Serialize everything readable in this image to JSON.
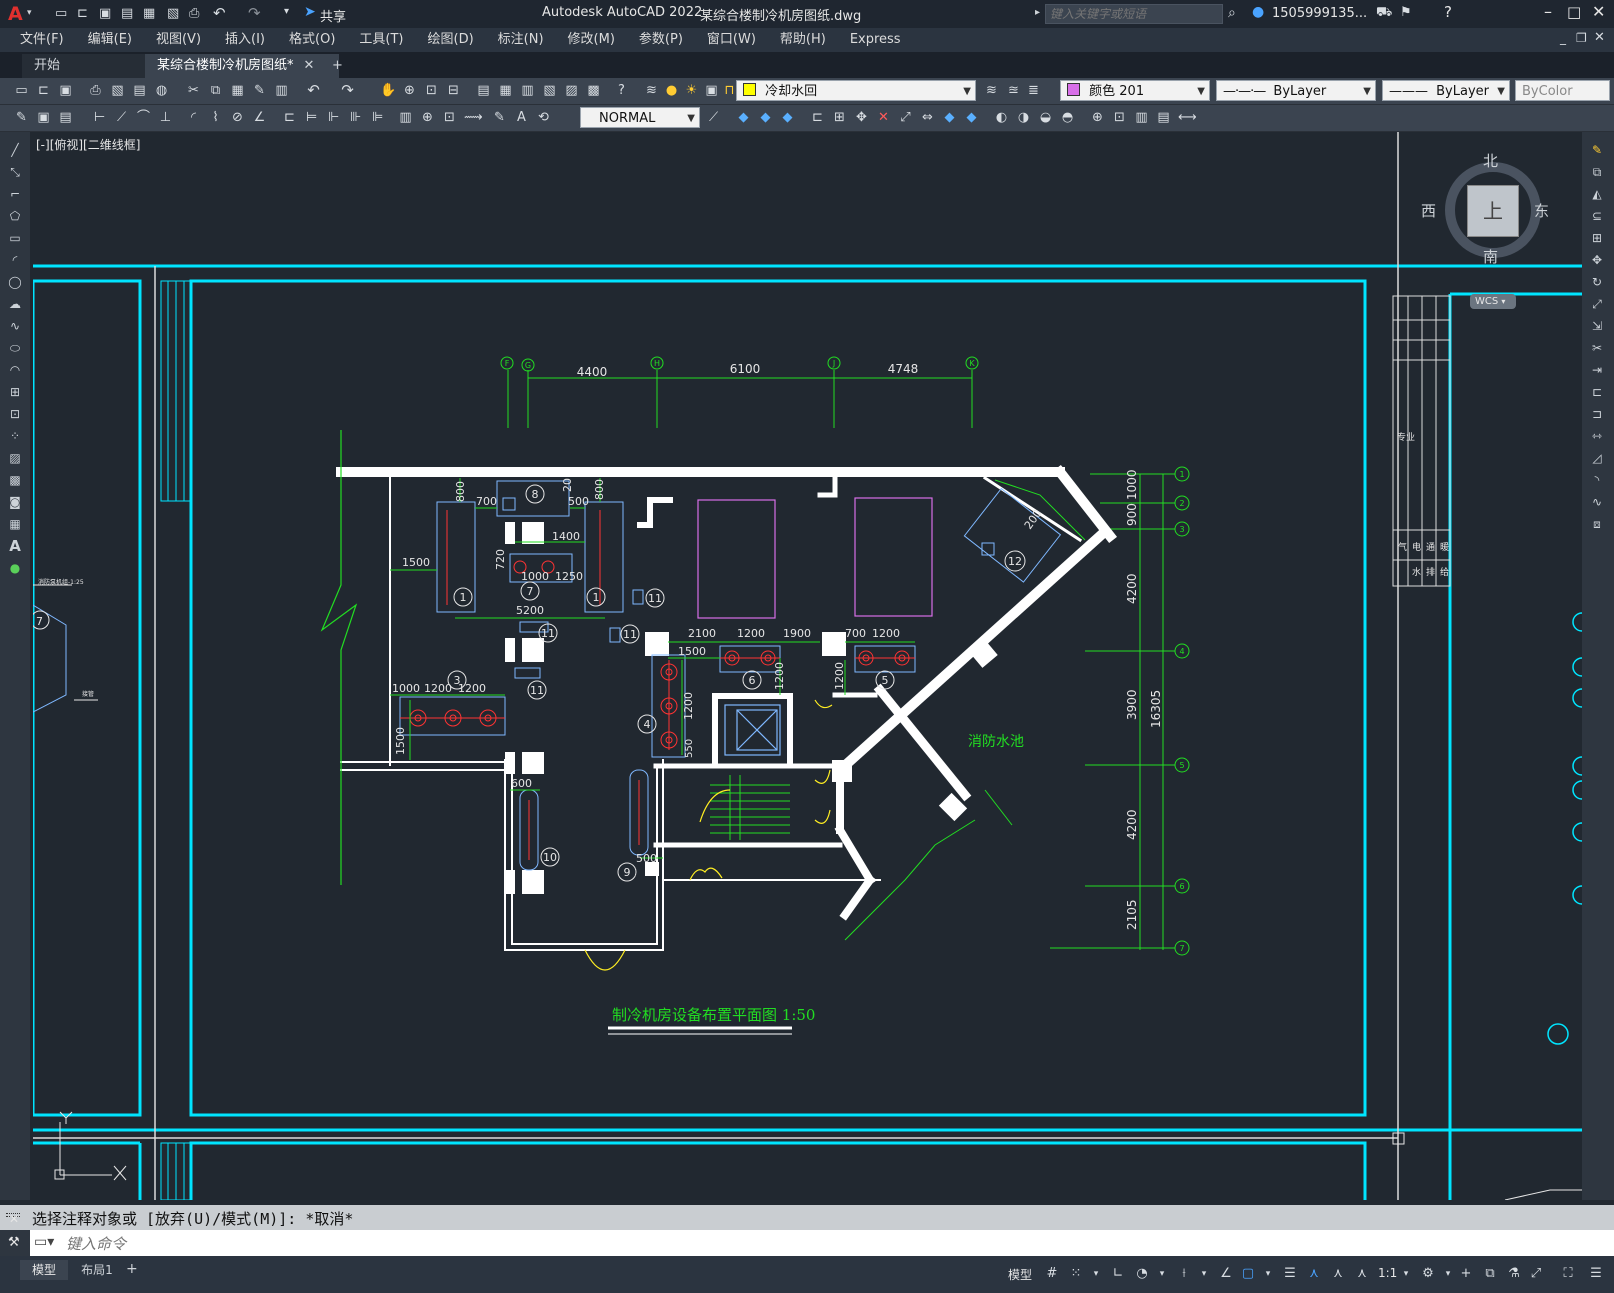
{
  "window": {
    "logo": "A",
    "app_title": "Autodesk AutoCAD 2022",
    "file_title": "某综合楼制冷机房图纸.dwg",
    "share_label": "共享",
    "search_placeholder": "键入关键字或短语",
    "user_name": "1505999135...",
    "help_icon": "question-icon"
  },
  "menu": [
    "文件(F)",
    "编辑(E)",
    "视图(V)",
    "插入(I)",
    "格式(O)",
    "工具(T)",
    "绘图(D)",
    "标注(N)",
    "修改(M)",
    "参数(P)",
    "窗口(W)",
    "帮助(H)",
    "Express"
  ],
  "tabs": {
    "start": "开始",
    "active": "某综合楼制冷机房图纸*",
    "add": "+"
  },
  "toolbar": {
    "layer_name": "冷却水回",
    "color_name": "颜色 201",
    "linetype": "ByLayer",
    "lineweight": "ByLayer",
    "plotstyle": "ByColor",
    "style_name": "NORMAL",
    "colors": {
      "layer_swatch": "#ffff00",
      "color_swatch": "#d86fe8"
    }
  },
  "viewport": {
    "label": "[-][俯视][二维线框]",
    "compass": {
      "north": "北",
      "south": "南",
      "east": "东",
      "west": "西",
      "top": "上",
      "wcs": "WCS"
    }
  },
  "drawing": {
    "title": "制冷机房设备布置平面图 1:50",
    "pool_label": "消防水池",
    "left_note": "消防泵机组-1:25",
    "left_note2": "接管",
    "top_dims": [
      "4400",
      "6100",
      "4748"
    ],
    "right_dims": [
      "1000",
      "900",
      "4200",
      "3900",
      "4200",
      "2105"
    ],
    "right_total": "16305",
    "inner_dims": {
      "d800a": "800",
      "d700": "700",
      "d20": "20",
      "d800b": "800",
      "d500a": "500",
      "d1400": "1400",
      "d1500a": "1500",
      "d720": "720",
      "d1000a": "1000",
      "d1250": "1250",
      "d5200": "5200",
      "d1000b": "1000",
      "d1200a": "1200",
      "d1200b": "1200",
      "d1500b": "1500",
      "d2100": "2100",
      "d1200c": "1200",
      "d1900": "1900",
      "d700b": "700",
      "d1200d": "1200",
      "d1500c": "1500",
      "d1200e": "1200",
      "d1200f": "1200",
      "d1200g": "1200",
      "d600": "600",
      "d500b": "500",
      "d200": "200",
      "d550": "550"
    },
    "equipment_tags": [
      "1",
      "1",
      "7",
      "8",
      "11",
      "11",
      "11",
      "11",
      "3",
      "4",
      "5",
      "6",
      "9",
      "10",
      "12",
      "7"
    ],
    "grid_top": [
      "F",
      "G",
      "H",
      "J",
      "K"
    ],
    "grid_right": [
      "1",
      "2",
      "3",
      "4",
      "5",
      "6",
      "7"
    ],
    "table_side": [
      "暖",
      "通",
      "电",
      "气",
      "给",
      "排",
      "水"
    ],
    "table_side2": [
      "专业"
    ],
    "left_tag": "7"
  },
  "command": {
    "history": "选择注释对象或 [放弃(U)/模式(M)]: *取消*",
    "placeholder": "键入命令"
  },
  "status": {
    "model_tab": "模型",
    "layout_tab": "布局1",
    "add": "+",
    "model_btn": "模型",
    "scale": "1:1"
  }
}
